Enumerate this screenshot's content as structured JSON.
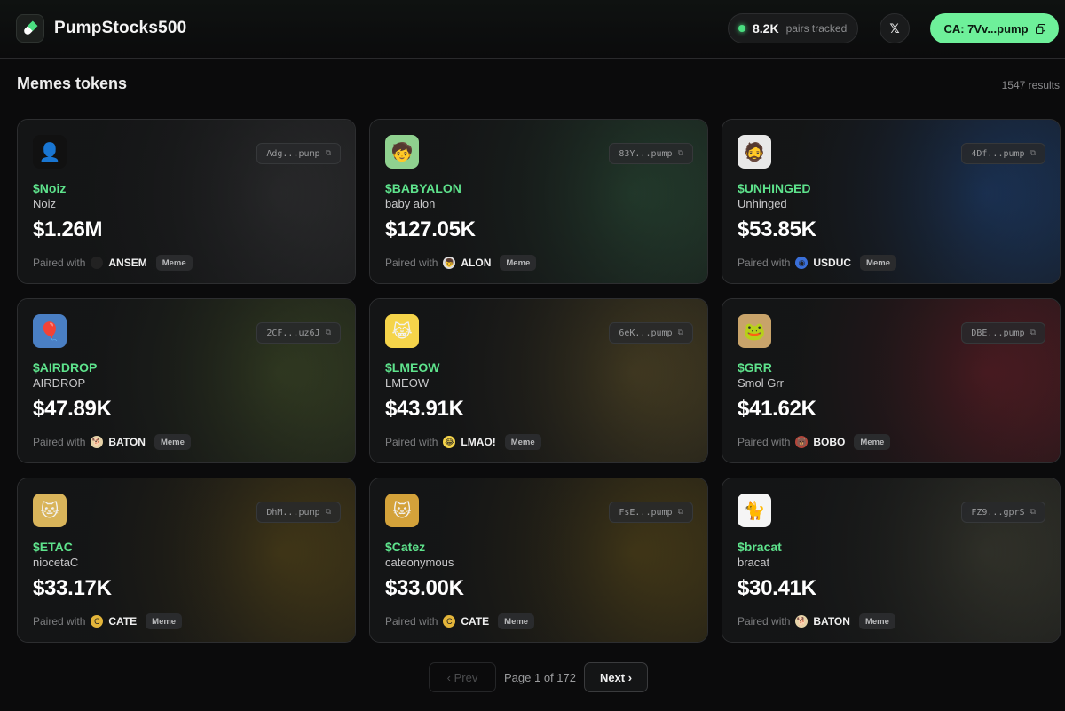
{
  "header": {
    "brand": "PumpStocks500",
    "tracked_count": "8.2K",
    "tracked_label": "pairs tracked",
    "x_label": "𝕏",
    "ca_label": "CA: 7Vv...pump"
  },
  "section": {
    "title": "Memes tokens",
    "results": "1547 results"
  },
  "cards": [
    {
      "address": "Adg...pump",
      "ticker": "$Noiz",
      "name": "Noiz",
      "mcap": "$1.26M",
      "paired_label": "Paired with",
      "paired_name": "ANSEM",
      "badge": "Meme",
      "accent": "#3a3a3c"
    },
    {
      "address": "83Y...pump",
      "ticker": "$BABYALON",
      "name": "baby alon",
      "mcap": "$127.05K",
      "paired_label": "Paired with",
      "paired_name": "ALON",
      "badge": "Meme",
      "accent": "#2f5a3e"
    },
    {
      "address": "4Df...pump",
      "ticker": "$UNHINGED",
      "name": "Unhinged",
      "mcap": "$53.85K",
      "paired_label": "Paired with",
      "paired_name": "USDUC",
      "badge": "Meme",
      "accent": "#1f4a8a"
    },
    {
      "address": "2CF...uz6J",
      "ticker": "$AIRDROP",
      "name": "AIRDROP",
      "mcap": "$47.89K",
      "paired_label": "Paired with",
      "paired_name": "BATON",
      "badge": "Meme",
      "accent": "#4a5a2a"
    },
    {
      "address": "6eK...pump",
      "ticker": "$LMEOW",
      "name": "LMEOW",
      "mcap": "$43.91K",
      "paired_label": "Paired with",
      "paired_name": "LMAO!",
      "badge": "Meme",
      "accent": "#6a5a2a"
    },
    {
      "address": "DBE...pump",
      "ticker": "$GRR",
      "name": "Smol Grr",
      "mcap": "$41.62K",
      "paired_label": "Paired with",
      "paired_name": "BOBO",
      "badge": "Meme",
      "accent": "#7a1f2a"
    },
    {
      "address": "DhM...pump",
      "ticker": "$ETAC",
      "name": "niocetaC",
      "mcap": "$33.17K",
      "paired_label": "Paired with",
      "paired_name": "CATE",
      "badge": "Meme",
      "accent": "#6a5518"
    },
    {
      "address": "FsE...pump",
      "ticker": "$Catez",
      "name": "cateonymous",
      "mcap": "$33.00K",
      "paired_label": "Paired with",
      "paired_name": "CATE",
      "badge": "Meme",
      "accent": "#6a5518"
    },
    {
      "address": "FZ9...gprS",
      "ticker": "$bracat",
      "name": "bracat",
      "mcap": "$30.41K",
      "paired_label": "Paired with",
      "paired_name": "BATON",
      "badge": "Meme",
      "accent": "#4a4a3a"
    }
  ],
  "pagination": {
    "prev_label": "‹ Prev",
    "page_info": "Page 1 of 172",
    "next_label": "Next ›"
  }
}
